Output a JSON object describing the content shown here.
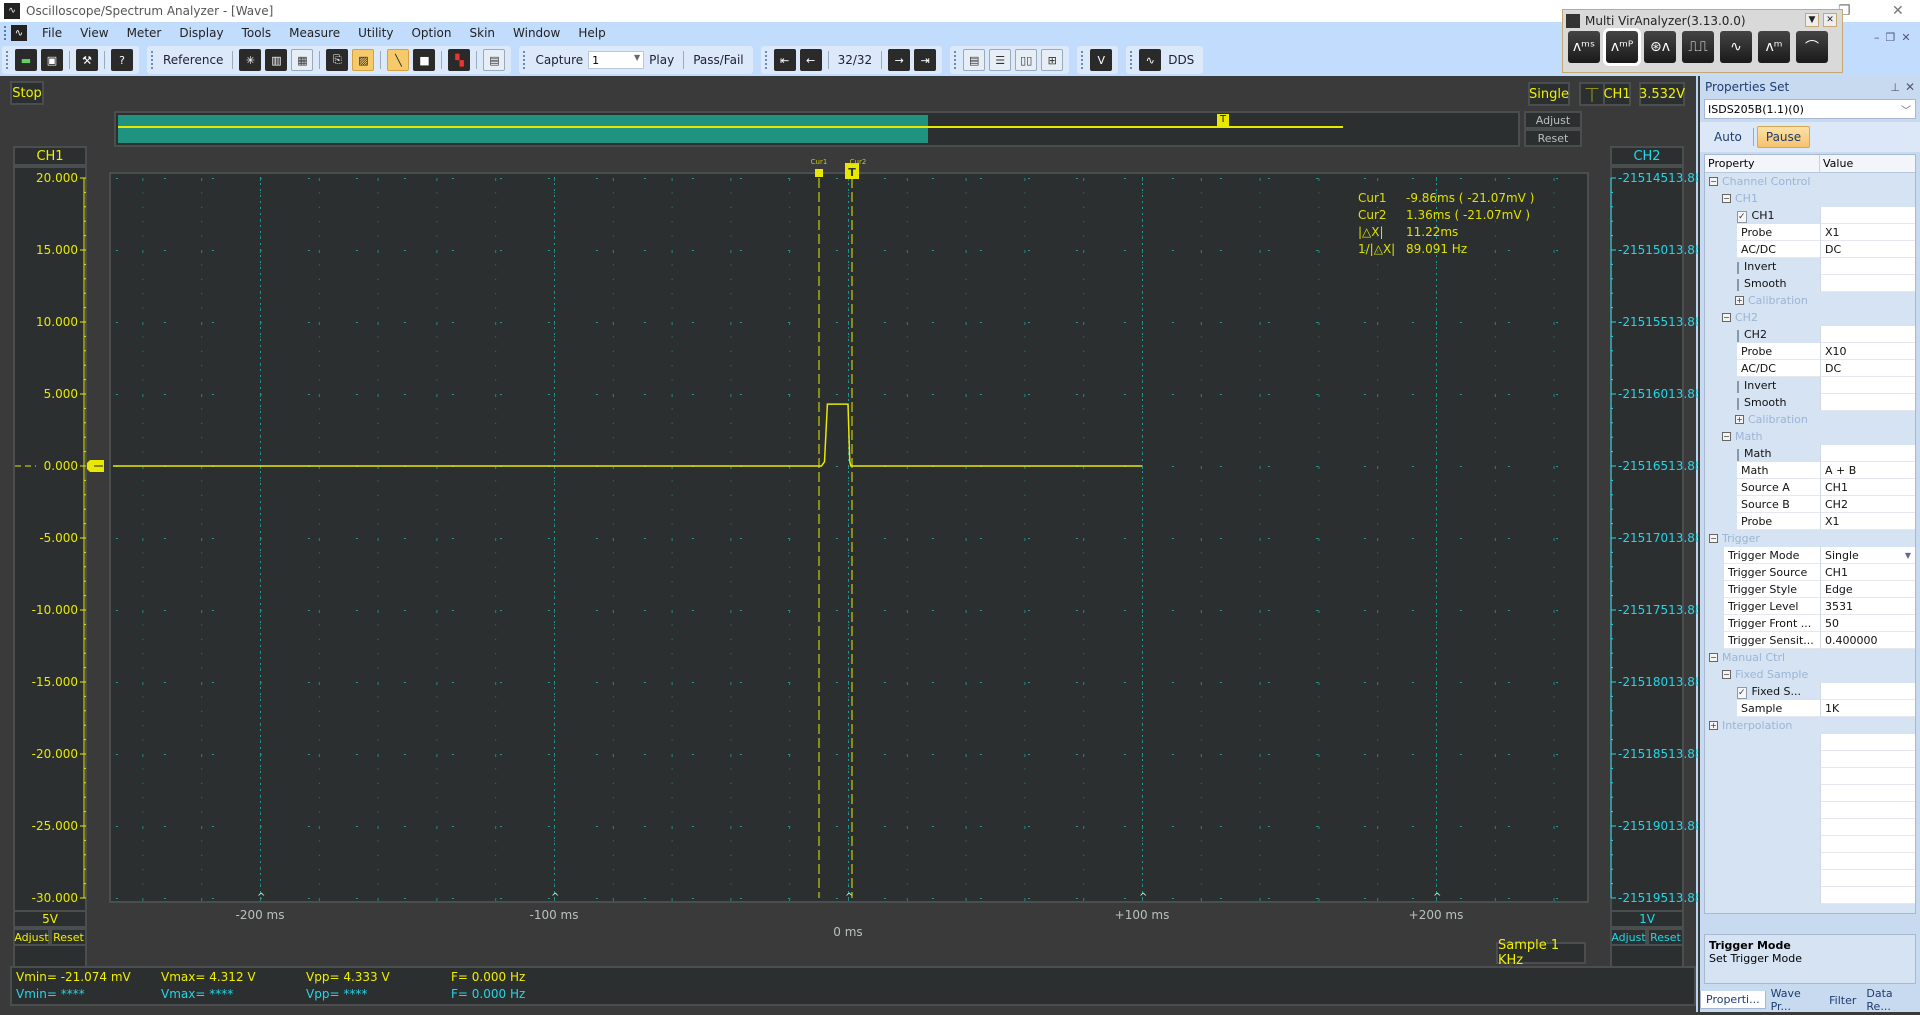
{
  "window": {
    "title": "Oscilloscope/Spectrum Analyzer - [Wave]",
    "controls": [
      "restore-icon",
      "close-icon"
    ]
  },
  "menu": [
    "File",
    "View",
    "Meter",
    "Display",
    "Tools",
    "Measure",
    "Utility",
    "Option",
    "Skin",
    "Window",
    "Help"
  ],
  "toolbar": {
    "reference_label": "Reference",
    "capture_label": "Capture",
    "capture_value": "1",
    "play_label": "Play",
    "passfail_label": "Pass/Fail",
    "frame_counter": "32/32",
    "dds_label": "DDS",
    "v_label": "V"
  },
  "multi_vir": {
    "title": "Multi VirAnalyzer(3.13.0.0)",
    "tools": [
      "spectrum-s-icon",
      "spectrum-p-icon",
      "recorder-icon",
      "pulse-icon",
      "waveform-icon",
      "spectrum-icon",
      "bell-curve-icon"
    ]
  },
  "scope": {
    "run_state": "Stop",
    "trigger_mode": "Single",
    "trigger_source": "CH1",
    "trigger_level": "3.532V",
    "overview_adjust": "Adjust",
    "overview_reset": "Reset",
    "ch1": {
      "label": "CH1",
      "scale": "5V",
      "adjust": "Adjust",
      "reset": "Reset",
      "color": "#f0f000",
      "ticks": [
        "20.000",
        "15.000",
        "10.000",
        "5.000",
        "0.000",
        "-5.000",
        "-10.000",
        "-15.000",
        "-20.000",
        "-25.000",
        "-30.000"
      ]
    },
    "ch2": {
      "label": "CH2",
      "scale": "1V",
      "adjust": "Adjust",
      "reset": "Reset",
      "color": "#27d5e6",
      "ticks": [
        "-21514513.88",
        "-21515013.88",
        "-21515513.88",
        "-21516013.88",
        "-21516513.88",
        "-21517013.88",
        "-21517513.88",
        "-21518013.88",
        "-21518513.88",
        "-21519013.88",
        "-21519513.88"
      ]
    },
    "time_labels": [
      {
        "t": -200,
        "text": "-200 ms"
      },
      {
        "t": -100,
        "text": "-100 ms"
      },
      {
        "t": 0,
        "text": "0 ms"
      },
      {
        "t": 100,
        "text": "+100 ms"
      },
      {
        "t": 200,
        "text": "+200 ms"
      }
    ],
    "sample_rate": "Sample 1 KHz",
    "cursors": {
      "cur1_label": "Cur1",
      "cur2_label": "Cur2",
      "cur1_ms": -9.86,
      "cur2_ms": 1.36,
      "rows": [
        {
          "k": "Cur1",
          "v": "-9.86ms ( -21.07mV )"
        },
        {
          "k": "Cur2",
          "v": "1.36ms ( -21.07mV )"
        },
        {
          "k": "|△X|",
          "v": "11.22ms"
        },
        {
          "k": "1/|△X|",
          "v": "89.091 Hz"
        }
      ]
    },
    "waveform": {
      "unit_x": "ms",
      "unit_y": "V",
      "points": [
        [
          -250,
          0
        ],
        [
          -9,
          0
        ],
        [
          -8,
          0.3
        ],
        [
          -7,
          4.3
        ],
        [
          0,
          4.3
        ],
        [
          0.6,
          0.3
        ],
        [
          1,
          0
        ],
        [
          100,
          0
        ]
      ]
    }
  },
  "measurements": {
    "ch1": {
      "vmin": "Vmin= -21.074 mV",
      "vmax": "Vmax= 4.312 V",
      "vpp": "Vpp= 4.333 V",
      "f": "F= 0.000 Hz"
    },
    "ch2": {
      "vmin": "Vmin= ****",
      "vmax": "Vmax= ****",
      "vpp": "Vpp= ****",
      "f": "F= 0.000 Hz"
    }
  },
  "properties": {
    "title": "Properties Set",
    "device": "ISDS205B(1.1)(0)",
    "mode_auto": "Auto",
    "mode_pause": "Pause",
    "col_property": "Property",
    "col_value": "Value",
    "rows": [
      {
        "type": "cat",
        "level": 0,
        "exp": "−",
        "name": "Channel Control"
      },
      {
        "type": "cat",
        "level": 1,
        "exp": "−",
        "name": "CH1"
      },
      {
        "type": "check",
        "level": 2,
        "name": "CH1",
        "checked": true,
        "value": ""
      },
      {
        "type": "item",
        "level": 2,
        "name": "Probe",
        "value": "X1"
      },
      {
        "type": "item",
        "level": 2,
        "name": "AC/DC",
        "value": "DC"
      },
      {
        "type": "check",
        "level": 2,
        "name": "Invert",
        "checked": false,
        "value": ""
      },
      {
        "type": "check",
        "level": 2,
        "name": "Smooth",
        "checked": false,
        "value": ""
      },
      {
        "type": "cat",
        "level": 2,
        "exp": "+",
        "name": "Calibration"
      },
      {
        "type": "cat",
        "level": 1,
        "exp": "−",
        "name": "CH2"
      },
      {
        "type": "check",
        "level": 2,
        "name": "CH2",
        "checked": false,
        "value": ""
      },
      {
        "type": "item",
        "level": 2,
        "name": "Probe",
        "value": "X10"
      },
      {
        "type": "item",
        "level": 2,
        "name": "AC/DC",
        "value": "DC"
      },
      {
        "type": "check",
        "level": 2,
        "name": "Invert",
        "checked": false,
        "value": ""
      },
      {
        "type": "check",
        "level": 2,
        "name": "Smooth",
        "checked": false,
        "value": ""
      },
      {
        "type": "cat",
        "level": 2,
        "exp": "+",
        "name": "Calibration"
      },
      {
        "type": "cat",
        "level": 1,
        "exp": "−",
        "name": "Math"
      },
      {
        "type": "check",
        "level": 2,
        "name": "Math",
        "checked": false,
        "value": ""
      },
      {
        "type": "item",
        "level": 2,
        "name": "Math",
        "value": "A + B"
      },
      {
        "type": "item",
        "level": 2,
        "name": "Source A",
        "value": "CH1"
      },
      {
        "type": "item",
        "level": 2,
        "name": "Source B",
        "value": "CH2"
      },
      {
        "type": "item",
        "level": 2,
        "name": "Probe",
        "value": "X1"
      },
      {
        "type": "cat",
        "level": 0,
        "exp": "−",
        "name": "Trigger"
      },
      {
        "type": "item",
        "level": 1,
        "name": "Trigger Mode",
        "value": "Single",
        "dropdown": true
      },
      {
        "type": "item",
        "level": 1,
        "name": "Trigger Source",
        "value": "CH1"
      },
      {
        "type": "item",
        "level": 1,
        "name": "Trigger Style",
        "value": "Edge"
      },
      {
        "type": "item",
        "level": 1,
        "name": "Trigger Level",
        "value": "3531"
      },
      {
        "type": "item",
        "level": 1,
        "name": "Trigger Front ...",
        "value": "50"
      },
      {
        "type": "item",
        "level": 1,
        "name": "Trigger Sensit...",
        "value": "0.400000"
      },
      {
        "type": "cat",
        "level": 0,
        "exp": "−",
        "name": "Manual Ctrl"
      },
      {
        "type": "cat",
        "level": 1,
        "exp": "−",
        "name": "Fixed Sample"
      },
      {
        "type": "check",
        "level": 2,
        "name": "Fixed S...",
        "checked": true,
        "value": ""
      },
      {
        "type": "item",
        "level": 2,
        "name": "Sample",
        "value": "1K"
      },
      {
        "type": "cat",
        "level": 0,
        "exp": "+",
        "name": "Interpolation"
      }
    ],
    "description_title": "Trigger Mode",
    "description_text": "Set Trigger Mode",
    "tabs": [
      "Properti...",
      "Wave Pr...",
      "Filter",
      "Data Re..."
    ]
  }
}
